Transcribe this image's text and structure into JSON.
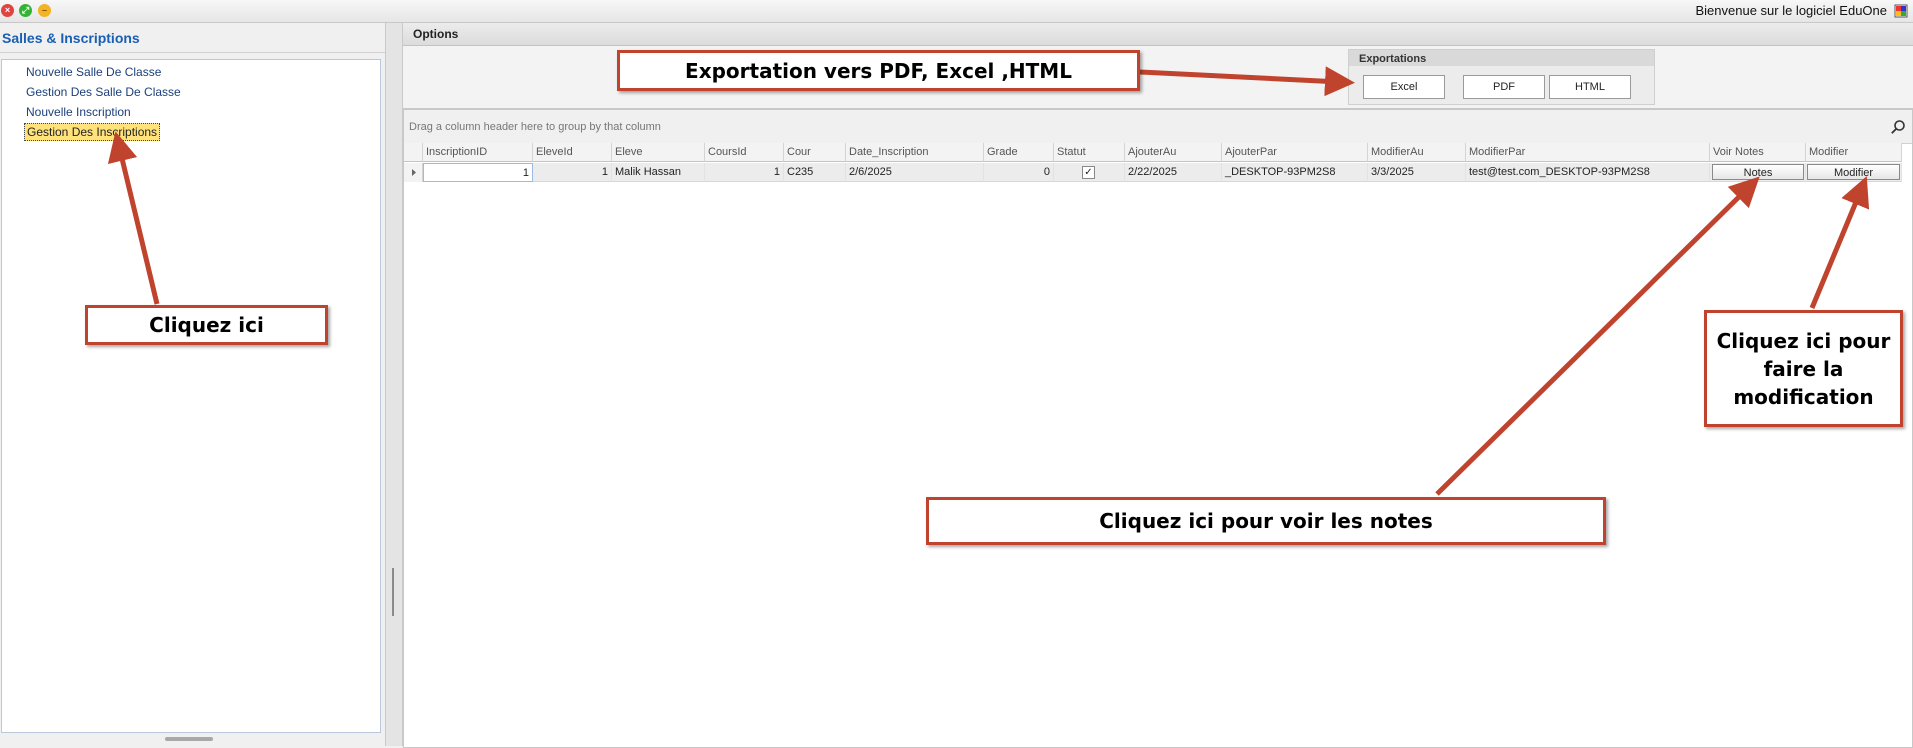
{
  "window": {
    "welcome_text": "Bienvenue sur le logiciel EduOne",
    "close_glyph": "×",
    "maximize_glyph": "⤢",
    "minimize_glyph": "–"
  },
  "sidebar": {
    "title": "Salles & Inscriptions",
    "items": [
      {
        "label": "Nouvelle Salle De Classe"
      },
      {
        "label": "Gestion Des Salle De Classe"
      },
      {
        "label": "Nouvelle Inscription"
      },
      {
        "label": "Gestion Des Inscriptions",
        "selected": true
      }
    ]
  },
  "options": {
    "label": "Options"
  },
  "exportations": {
    "title": "Exportations",
    "buttons": [
      "Excel",
      "PDF",
      "HTML"
    ]
  },
  "grid": {
    "group_hint": "Drag a column header here to group by that column",
    "columns": [
      "InscriptionID",
      "EleveId",
      "Eleve",
      "CoursId",
      "Cour",
      "Date_Inscription",
      "Grade",
      "Statut",
      "AjouterAu",
      "AjouterPar",
      "ModifierAu",
      "ModifierPar",
      "Voir Notes",
      "Modifier"
    ],
    "rows": [
      {
        "InscriptionID": "1",
        "EleveId": "1",
        "Eleve": "Malik Hassan",
        "CoursId": "1",
        "Cour": "C235",
        "Date_Inscription": "2/6/2025",
        "Grade": "0",
        "Statut": "✓",
        "AjouterAu": "2/22/2025",
        "AjouterPar": "_DESKTOP-93PM2S8",
        "ModifierAu": "3/3/2025",
        "ModifierPar": "test@test.com_DESKTOP-93PM2S8",
        "notes_button": "Notes",
        "modifier_button": "Modifier"
      }
    ]
  },
  "annotations": {
    "export_callout": "Exportation vers PDF, Excel ,HTML",
    "click_here": "Cliquez ici",
    "notes_callout": "Cliquez ici pour voir les notes",
    "modify_callout": "Cliquez ici pour faire la modification",
    "arrow_color": "#c0432e"
  }
}
